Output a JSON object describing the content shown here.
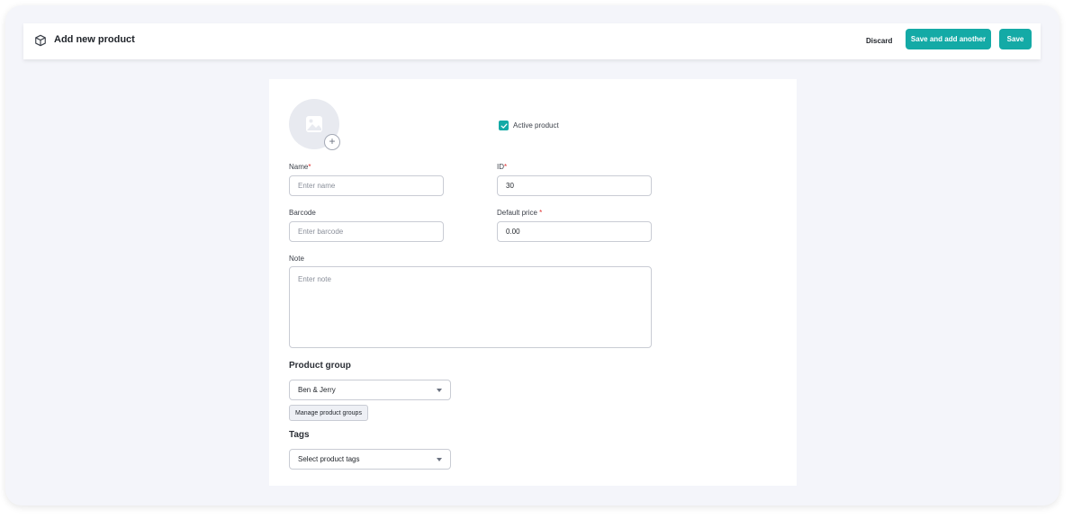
{
  "header": {
    "title": "Add new product",
    "discard_label": "Discard",
    "save_and_add_label": "Save and add another",
    "save_label": "Save"
  },
  "form": {
    "active_label": "Active product",
    "name": {
      "label": "Name",
      "placeholder": "Enter name",
      "value": ""
    },
    "id": {
      "label": "ID",
      "value": "30"
    },
    "barcode": {
      "label": "Barcode",
      "placeholder": "Enter barcode",
      "value": ""
    },
    "default_price": {
      "label": "Default price",
      "value": "0.00"
    },
    "note": {
      "label": "Note",
      "placeholder": "Enter note"
    },
    "required_mark": "*",
    "product_group": {
      "title": "Product group",
      "selected": "Ben & Jerry",
      "manage_label": "Manage product groups"
    },
    "tags": {
      "title": "Tags",
      "placeholder": "Select product tags"
    }
  },
  "colors": {
    "accent": "#14aaa6",
    "background": "#f4f5fa",
    "required": "#e03030"
  },
  "icons": {
    "header": "box-icon",
    "avatar": "image-icon",
    "avatar_add": "plus-icon",
    "checkbox": "check-icon",
    "select": "caret-down-icon"
  }
}
